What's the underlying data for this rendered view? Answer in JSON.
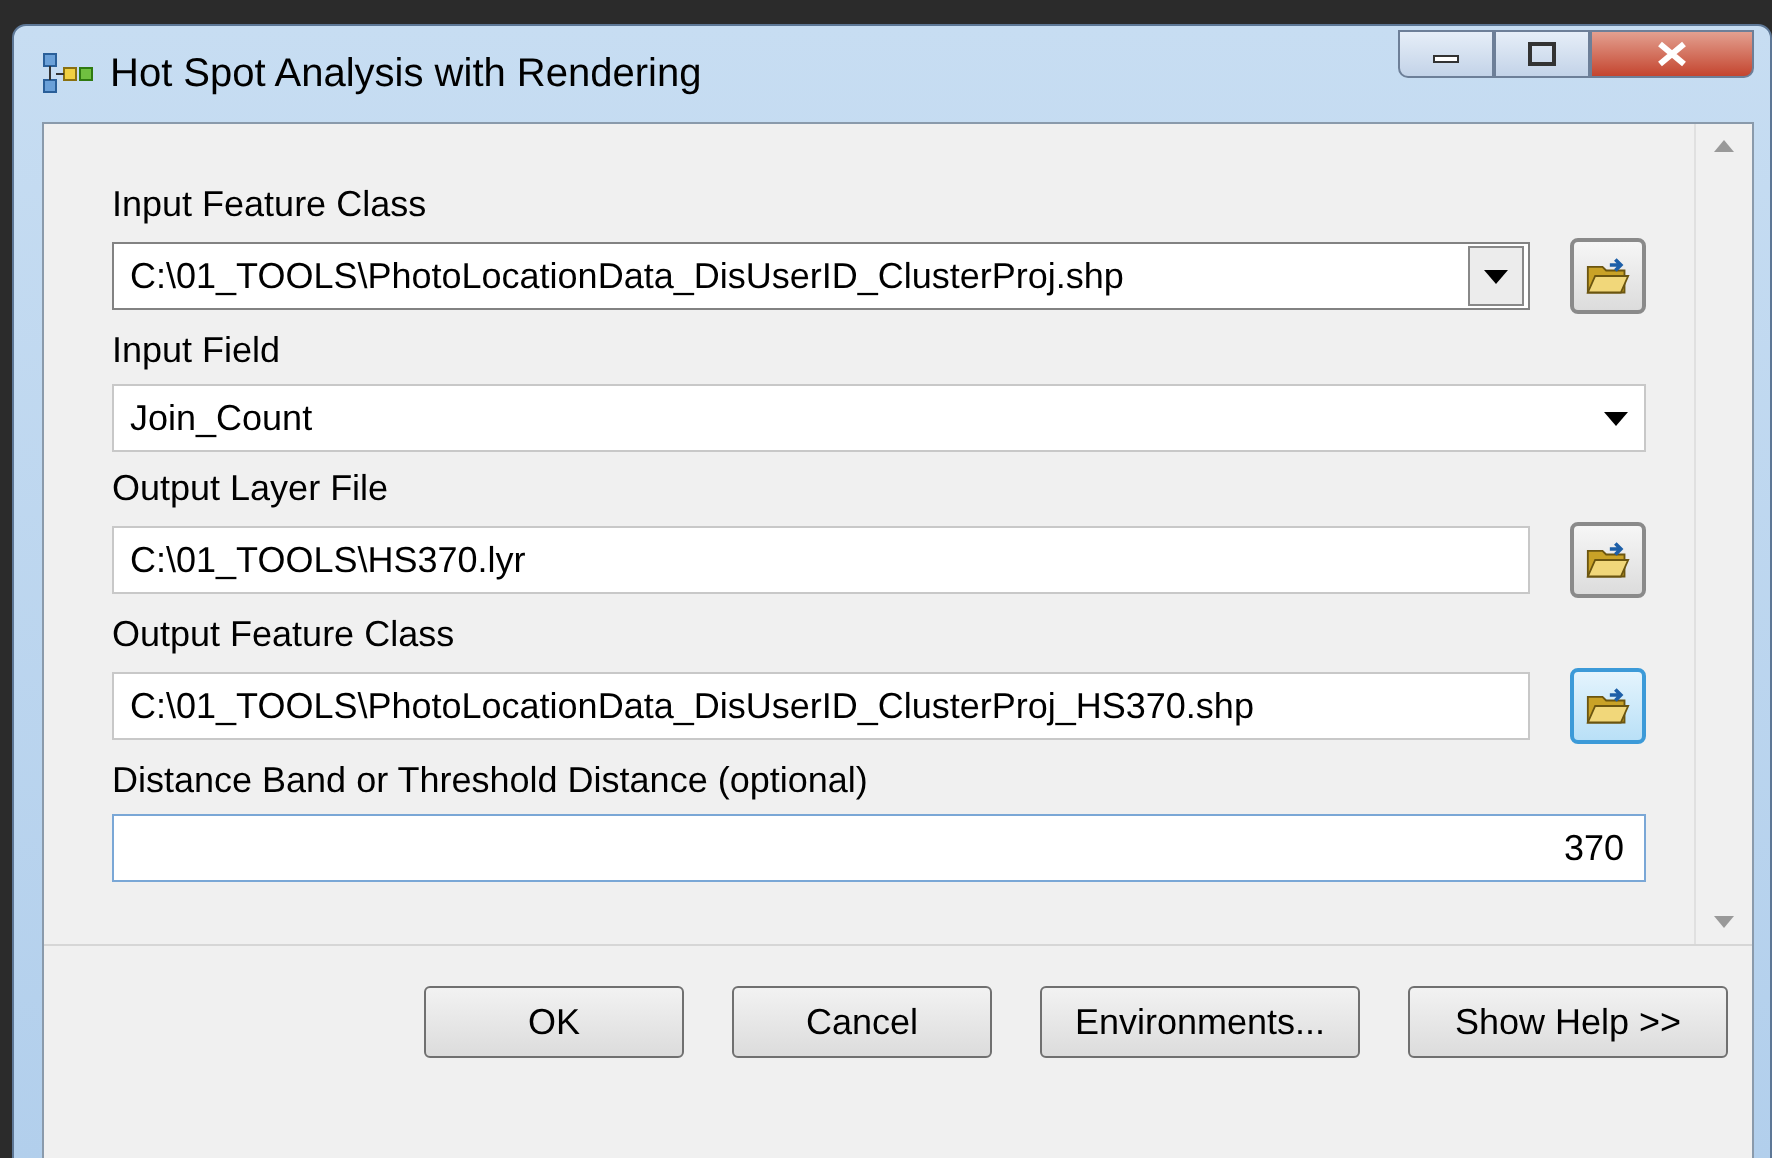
{
  "window": {
    "title": "Hot Spot Analysis with Rendering"
  },
  "parameters": [
    {
      "label": "Input Feature Class",
      "kind": "combo",
      "value": "C:\\01_TOOLS\\PhotoLocationData_DisUserID_ClusterProj.shp",
      "browse_highlighted": false
    },
    {
      "label": "Input Field",
      "kind": "dropdown",
      "value": "Join_Count"
    },
    {
      "label": "Output Layer File",
      "kind": "file",
      "value": "C:\\01_TOOLS\\HS370.lyr",
      "browse_highlighted": false
    },
    {
      "label": "Output Feature Class",
      "kind": "file",
      "value": "C:\\01_TOOLS\\PhotoLocationData_DisUserID_ClusterProj_HS370.shp",
      "browse_highlighted": true
    },
    {
      "label": "Distance Band or Threshold Distance (optional)",
      "kind": "number",
      "value": "370"
    }
  ],
  "buttons": [
    "OK",
    "Cancel",
    "Environments...",
    "Show Help >>"
  ]
}
